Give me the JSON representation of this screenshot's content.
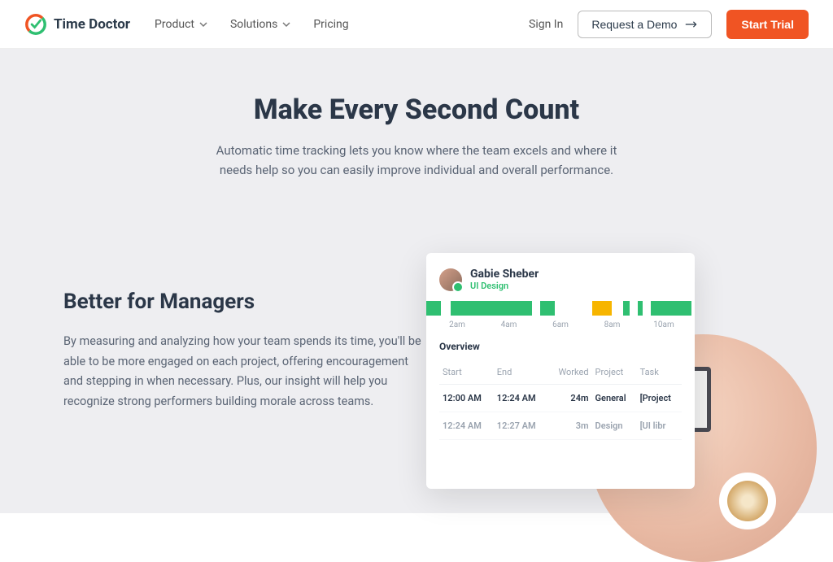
{
  "brand": {
    "name": "Time Doctor"
  },
  "nav": {
    "items": [
      {
        "label": "Product",
        "has_dropdown": true
      },
      {
        "label": "Solutions",
        "has_dropdown": true
      },
      {
        "label": "Pricing",
        "has_dropdown": false
      }
    ],
    "sign_in": "Sign In",
    "demo": "Request a Demo",
    "trial": "Start Trial"
  },
  "hero": {
    "title": "Make Every Second Count",
    "subtitle": "Automatic time tracking lets you know where the team excels and where it needs help so you can easily improve individual and overall performance."
  },
  "section": {
    "title": "Better for Managers",
    "body": "By measuring and analyzing how your team spends its time, you'll be able to be more engaged on each project, offering encouragement and stepping in when necessary. Plus, our insight will help you recognize strong performers building morale across teams."
  },
  "card": {
    "user": {
      "name": "Gabie Sheber",
      "role": "UI Design"
    },
    "time_labels": [
      "2am",
      "4am",
      "6am",
      "8am",
      "10am"
    ],
    "overview": "Overview",
    "columns": {
      "start": "Start",
      "end": "End",
      "worked": "Worked",
      "project": "Project",
      "task": "Task"
    },
    "rows": [
      {
        "start": "12:00 AM",
        "end": "12:24 AM",
        "worked": "24m",
        "project": "General",
        "task": "[Project"
      },
      {
        "start": "12:24 AM",
        "end": "12:27 AM",
        "worked": "3m",
        "project": "Design",
        "task": "[UI libr"
      }
    ]
  }
}
